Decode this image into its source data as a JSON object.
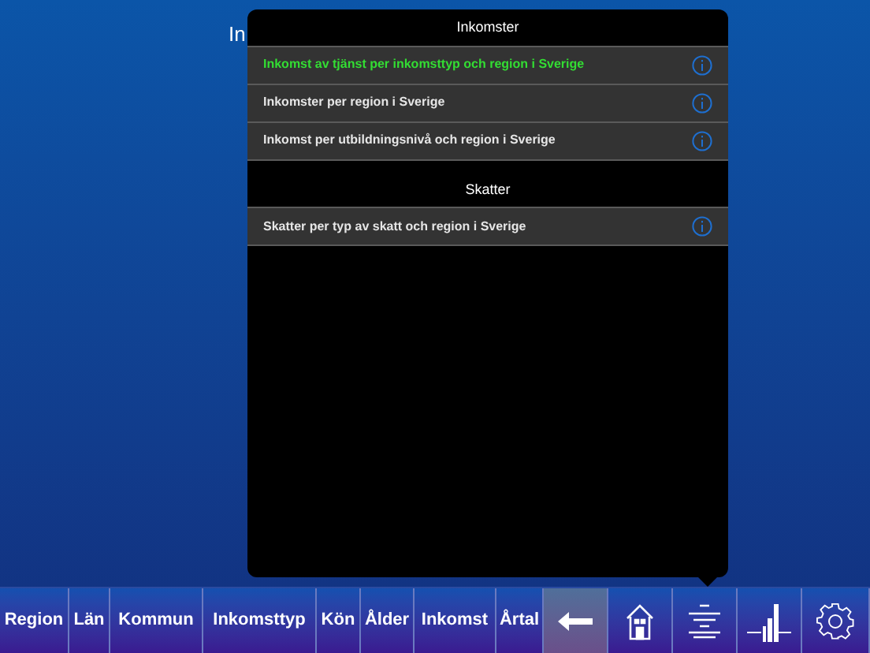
{
  "page_title": "In",
  "popover": {
    "sections": [
      {
        "title": "Inkomster",
        "rows": [
          {
            "label": "Inkomst av tjänst per inkomsttyp och region i Sverige",
            "selected": true
          },
          {
            "label": "Inkomster per region i Sverige",
            "selected": false
          },
          {
            "label": "Inkomst per utbildningsnivå och region i Sverige",
            "selected": false
          }
        ]
      },
      {
        "title": "Skatter",
        "rows": [
          {
            "label": "Skatter per typ av skatt och region i Sverige",
            "selected": false
          }
        ]
      }
    ]
  },
  "toolbar": [
    {
      "kind": "text",
      "label": "Region",
      "selected": false
    },
    {
      "kind": "text",
      "label": "Län",
      "selected": false
    },
    {
      "kind": "text",
      "label": "Kommun",
      "selected": false
    },
    {
      "kind": "text",
      "label": "Inkomsttyp",
      "selected": false
    },
    {
      "kind": "text",
      "label": "Kön",
      "selected": false
    },
    {
      "kind": "text",
      "label": "Ålder",
      "selected": false
    },
    {
      "kind": "text",
      "label": "Inkomst",
      "selected": false
    },
    {
      "kind": "text",
      "label": "Årtal",
      "selected": false
    },
    {
      "kind": "back",
      "selected": true
    },
    {
      "kind": "home",
      "selected": false
    },
    {
      "kind": "list",
      "selected": false
    },
    {
      "kind": "chart",
      "selected": false
    },
    {
      "kind": "settings",
      "selected": false
    }
  ]
}
